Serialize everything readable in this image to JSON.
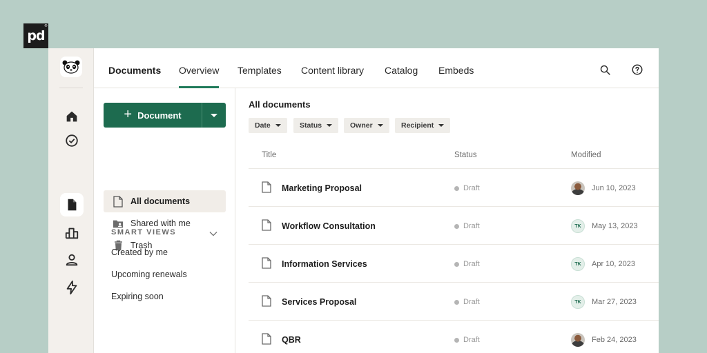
{
  "brand": {
    "logo_text": "pd"
  },
  "nav": {
    "title": "Documents",
    "tabs": [
      {
        "label": "Overview",
        "active": true
      },
      {
        "label": "Templates",
        "active": false
      },
      {
        "label": "Content library",
        "active": false
      },
      {
        "label": "Catalog",
        "active": false
      },
      {
        "label": "Embeds",
        "active": false
      }
    ],
    "icons": [
      "search-icon",
      "help-icon"
    ]
  },
  "rail": {
    "icons": [
      "panda-logo-icon",
      "home-icon",
      "check-circle-icon",
      "document-icon",
      "chart-icon",
      "person-icon",
      "lightning-icon"
    ],
    "active": "document-icon"
  },
  "sidebar": {
    "new_button_label": "Document",
    "folders": [
      {
        "label": "All documents",
        "icon": "document-outline-icon",
        "active": true
      },
      {
        "label": "Shared with me",
        "icon": "shared-folder-icon",
        "active": false
      },
      {
        "label": "Trash",
        "icon": "trash-icon",
        "active": false
      }
    ],
    "smart_views_header": "SMART VIEWS",
    "smart_views": [
      "Created by me",
      "Upcoming renewals",
      "Expiring soon"
    ]
  },
  "main": {
    "title": "All documents",
    "filters": [
      "Date",
      "Status",
      "Owner",
      "Recipient"
    ],
    "columns": [
      "Title",
      "Status",
      "Modified"
    ],
    "rows": [
      {
        "title": "Marketing Proposal",
        "status": "Draft",
        "avatar": "photo",
        "initials": "",
        "modified": "Jun 10, 2023"
      },
      {
        "title": "Workflow Consultation",
        "status": "Draft",
        "avatar": "initials",
        "initials": "TK",
        "modified": "May 13, 2023"
      },
      {
        "title": "Information Services",
        "status": "Draft",
        "avatar": "initials",
        "initials": "TK",
        "modified": "Apr 10, 2023"
      },
      {
        "title": "Services Proposal",
        "status": "Draft",
        "avatar": "initials",
        "initials": "TK",
        "modified": "Mar 27, 2023"
      },
      {
        "title": "QBR",
        "status": "Draft",
        "avatar": "photo",
        "initials": "",
        "modified": "Feb 24, 2023"
      }
    ]
  },
  "colors": {
    "background": "#b7cec6",
    "accent": "#1d6b4f",
    "rail": "#f3f0ec"
  }
}
